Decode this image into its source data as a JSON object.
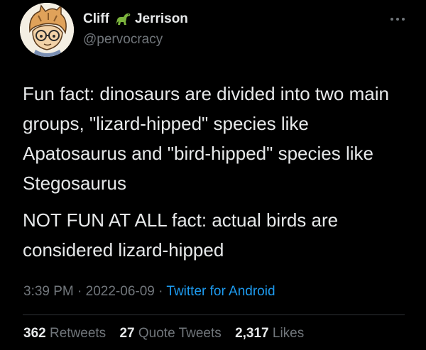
{
  "author": {
    "name_first": "Cliff",
    "name_last": "Jerrison",
    "name_emoji": "dinosaur-icon",
    "handle": "@pervocracy",
    "avatar": "cartoon-cat-avatar"
  },
  "more_icon": "more-options-icon",
  "tweet": {
    "paragraphs": [
      "Fun fact: dinosaurs are divided into two main groups, \"lizard-hipped\" species like Apatosaurus and \"bird-hipped\" species like Stegosaurus",
      "NOT FUN AT ALL fact: actual birds are considered lizard-hipped"
    ]
  },
  "meta": {
    "time": "3:39 PM",
    "separator": "·",
    "date": "2022-06-09",
    "source": "Twitter for Android"
  },
  "stats": {
    "retweets_count": "362",
    "retweets_label": "Retweets",
    "quotes_count": "27",
    "quotes_label": "Quote Tweets",
    "likes_count": "2,317",
    "likes_label": "Likes"
  },
  "colors": {
    "background": "#000000",
    "text": "#e7e9ea",
    "secondary": "#71767b",
    "link": "#1d9bf0",
    "divider": "#2f3336"
  }
}
